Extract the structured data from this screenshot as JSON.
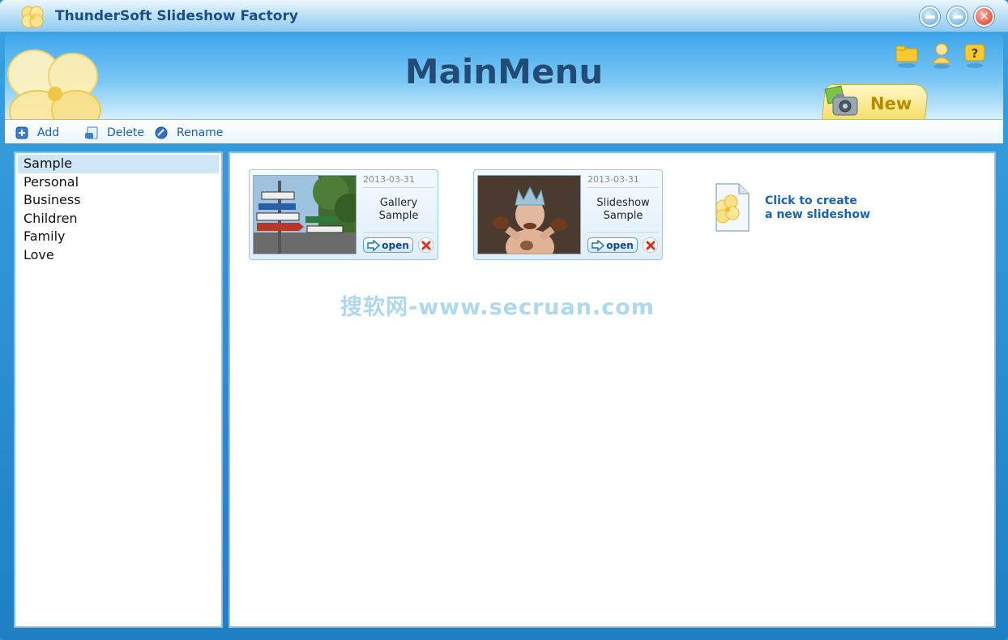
{
  "window": {
    "title": "ThunderSoft Slideshow Factory"
  },
  "header": {
    "title": "MainMenu",
    "new_tab_label": "New"
  },
  "toolbar": {
    "add_label": "Add",
    "delete_label": "Delete",
    "rename_label": "Rename"
  },
  "categories": {
    "selected": "Sample",
    "items": [
      "Sample",
      "Personal",
      "Business",
      "Children",
      "Family",
      "Love"
    ]
  },
  "projects": [
    {
      "date": "2013-03-31",
      "name_line1": "Gallery",
      "name_line2": "Sample",
      "open_label": "open"
    },
    {
      "date": "2013-03-31",
      "name_line1": "Slideshow",
      "name_line2": "Sample",
      "open_label": "open"
    }
  ],
  "create_new": {
    "line1": "Click to create",
    "line2": "a new slideshow"
  },
  "watermark": "搜软网-www.secruan.com",
  "colors": {
    "accent": "#1f7fc4",
    "title_text": "#1d4f86",
    "link_text": "#1b63ad",
    "selected_bg": "#cfe6f7",
    "close_red": "#e0301c"
  },
  "icons": {
    "app": "clover-logo-icon",
    "minimize": "minimize-icon",
    "restore": "restore-icon",
    "close": "close-icon",
    "folder": "folder-icon",
    "user": "user-icon",
    "help": "help-icon",
    "add": "add-icon",
    "delete": "delete-icon",
    "rename": "rename-icon",
    "open": "arrow-right-icon",
    "remove": "red-x-icon",
    "new_slideshow": "new-document-icon"
  }
}
